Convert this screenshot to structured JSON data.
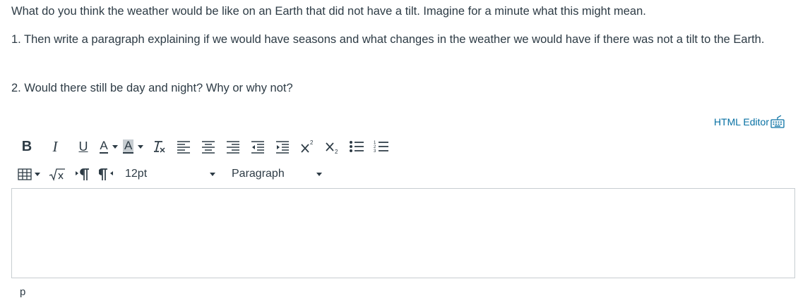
{
  "question": {
    "intro": "What do you think the weather would be like on an Earth that did not have a tilt. Imagine for a minute what this might mean.",
    "item1": "1. Then write a paragraph explaining if we would have seasons and what changes in the weather we would have if there was not a tilt to the Earth.",
    "item2": "2. Would there still be day and night? Why or why not?"
  },
  "html_editor_link": "HTML Editor",
  "toolbar": {
    "bold": "B",
    "italic": "I",
    "underline": "U",
    "text_color": "A",
    "bg_color": "A",
    "font_size": "12pt",
    "block_format": "Paragraph"
  },
  "status_bar": {
    "path": "p"
  },
  "icons": [
    "keyboard-icon",
    "clear-format-icon",
    "align-left-icon",
    "align-center-icon",
    "align-right-icon",
    "outdent-icon",
    "indent-icon",
    "superscript-icon",
    "subscript-icon",
    "bullet-list-icon",
    "numbered-list-icon",
    "table-icon",
    "equation-icon",
    "ltr-icon",
    "rtl-icon"
  ],
  "colors": {
    "link": "#0770a3",
    "text": "#2d3b45",
    "border": "#c7cdd1"
  }
}
